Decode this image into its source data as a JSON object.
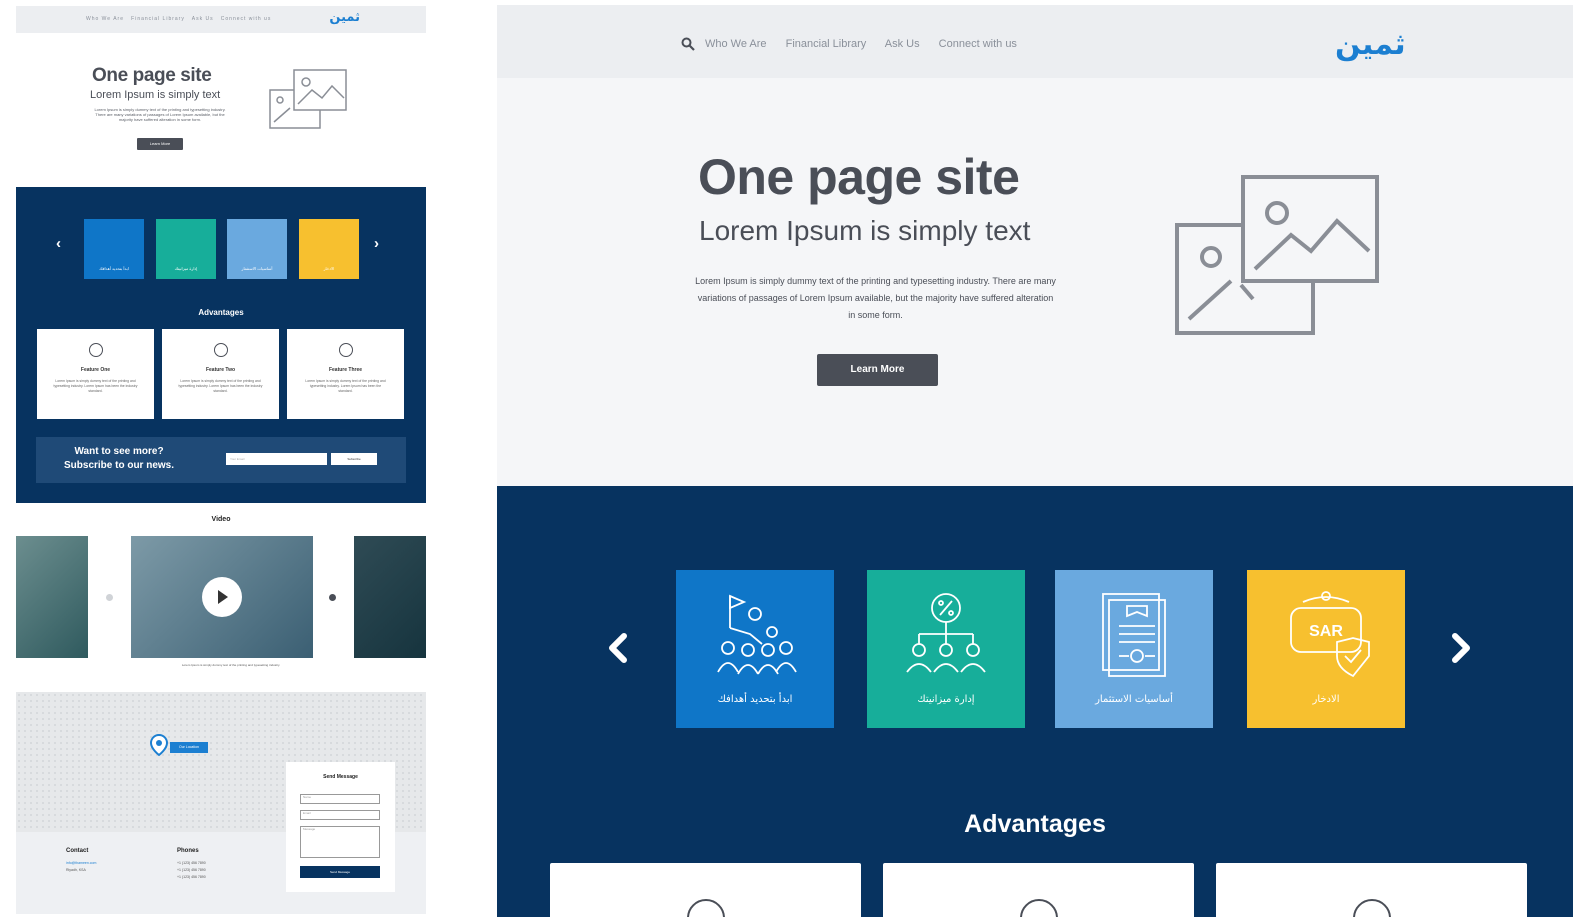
{
  "nav": {
    "links": [
      "Who We Are",
      "Financial Library",
      "Ask Us",
      "Connect with us"
    ],
    "logo_text": "ثمين"
  },
  "hero": {
    "title": "One page site",
    "subtitle": "Lorem Ipsum is simply text",
    "body": "Lorem Ipsum is simply dummy text of the printing and typesetting industry. There are many variations of passages of Lorem Ipsum available, but the majority have suffered alteration in some form.",
    "button_label": "Learn More"
  },
  "tiles": [
    {
      "label": "ابدأ بتحديد أهدافك",
      "color": "#0f76c8",
      "icon": "goal-people-icon"
    },
    {
      "label": "إدارة ميزانيتك",
      "color": "#17ae9a",
      "icon": "percent-network-icon"
    },
    {
      "label": "أساسيات الاستثمار",
      "color": "#6aa9df",
      "icon": "certificate-icon"
    },
    {
      "label": "الادخار",
      "color": "#f7c02f",
      "icon": "wallet-sar-icon"
    }
  ],
  "tile_wallet_text": "SAR",
  "advantages": {
    "heading": "Advantages",
    "features": [
      {
        "title": "Feature One",
        "body": "Lorem Ipsum is simply dummy text of the printing and typesetting industry. Lorem Ipsum has been the industry standard."
      },
      {
        "title": "Feature Two",
        "body": "Lorem Ipsum is simply dummy text of the printing and typesetting industry. Lorem Ipsum has been the industry standard."
      },
      {
        "title": "Feature Three",
        "body": "Lorem Ipsum is simply dummy text of the printing and typesetting industry. Lorem Ipsum has been the standard."
      }
    ]
  },
  "subscribe": {
    "line1": "Want to see more?",
    "line2": "Subscribe to our news.",
    "input_placeholder": "Your Email",
    "button_label": "Subscribe"
  },
  "video": {
    "heading": "Video",
    "caption": "Lorem Ipsum is simply dummy text of the printing and typesetting industry."
  },
  "map": {
    "pin_label": "Our Location"
  },
  "footer": {
    "contact_heading": "Contact",
    "contact_lines": [
      "info@thameen.com",
      "Riyadh, KSA"
    ],
    "phones_heading": "Phones",
    "phone_lines": [
      "+1 (123) 456 7890",
      "+1 (123) 456 7890",
      "+1 (123) 456 7890"
    ]
  },
  "form": {
    "heading": "Send Message",
    "name_placeholder": "Name",
    "email_placeholder": "Email",
    "message_placeholder": "Message",
    "button_label": "Send Message"
  },
  "colors": {
    "navy": "#073360",
    "brand_blue": "#1c7fd1",
    "text_dark": "#4a4e57",
    "nav_bg": "#eceef1",
    "hero_bg": "#f5f6f8"
  }
}
